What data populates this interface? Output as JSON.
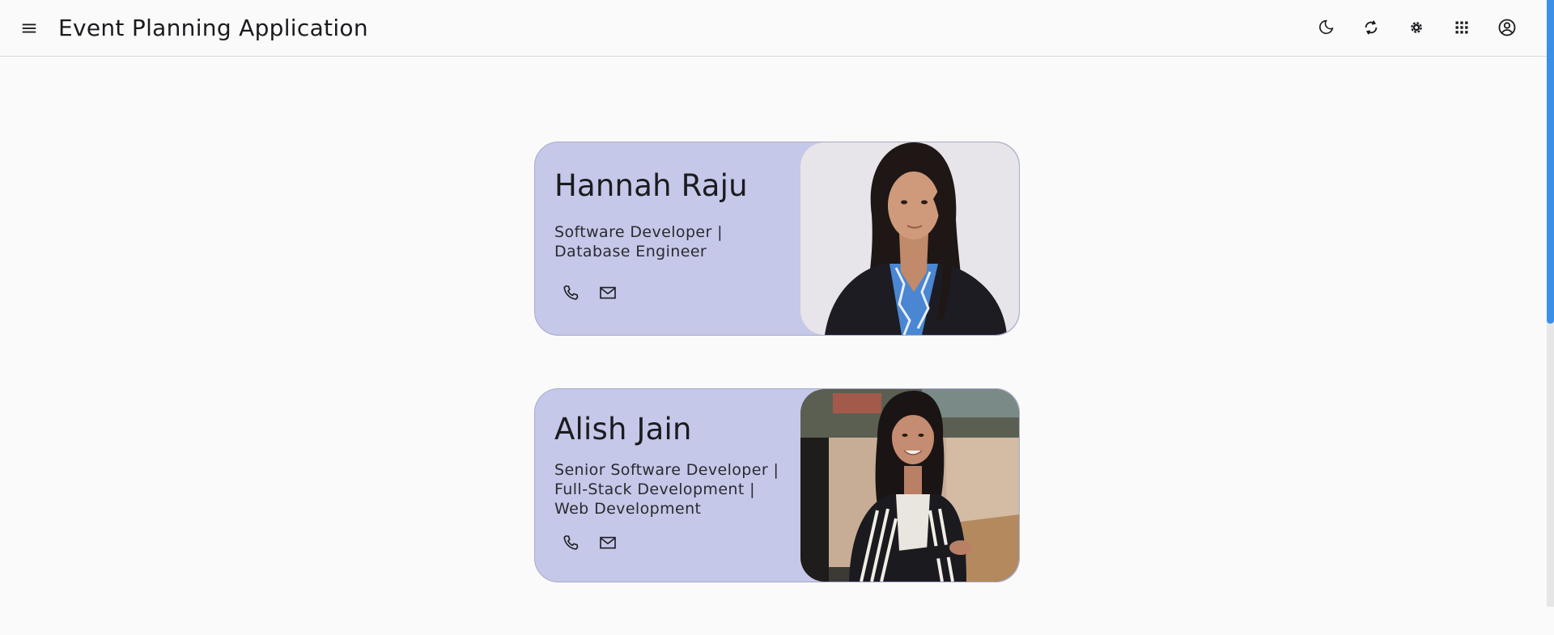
{
  "app": {
    "title": "Event Planning Application",
    "icons": {
      "menu": "menu-icon",
      "theme": "dark-mode-icon",
      "sync": "sync-icon",
      "settings": "settings-icon",
      "apps": "apps-grid-icon",
      "account": "account-circle-icon"
    }
  },
  "profiles": [
    {
      "name": "Hannah Raju",
      "role_lines": [
        "Software Developer |",
        "Database Engineer"
      ],
      "photo": "portrait of Hannah Raju",
      "contacts": [
        "phone-icon",
        "email-icon"
      ]
    },
    {
      "name": "Alish Jain",
      "role_lines": [
        "Senior Software Developer |",
        "Full-Stack Development |",
        "Web Development"
      ],
      "photo": "portrait of Alish Jain",
      "contacts": [
        "phone-icon",
        "email-icon"
      ]
    }
  ],
  "colors": {
    "card_bg": "#c5c8e8",
    "page_bg": "#fafafa",
    "scroll_thumb": "#3a90e8"
  }
}
